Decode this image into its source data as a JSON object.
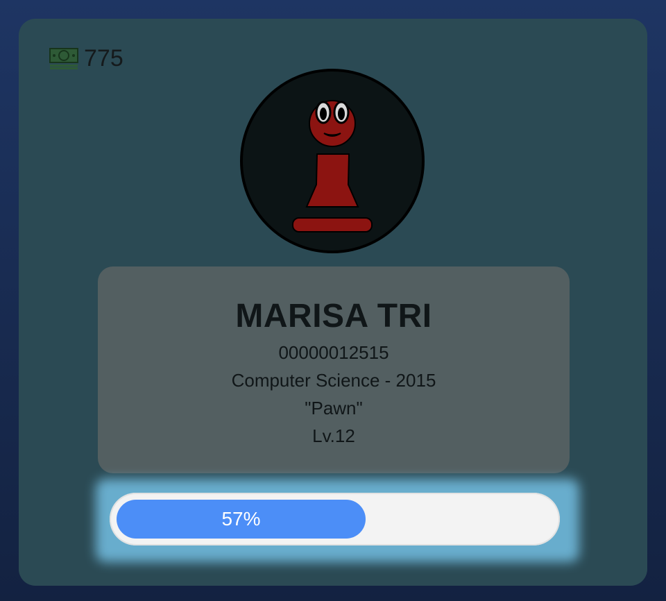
{
  "wallet": {
    "icon": "cash-icon",
    "amount": "775"
  },
  "avatar": {
    "icon": "pawn-character-icon"
  },
  "profile": {
    "name": "MARISA TRI",
    "id": "00000012515",
    "program": "Computer Science - 2015",
    "title": "\"Pawn\"",
    "level": "Lv.12"
  },
  "progress": {
    "percent": 57,
    "label": "57%"
  },
  "colors": {
    "background": "#1e3563",
    "card": "#2b4a54",
    "info_box": "#535f61",
    "progress_fill": "#4c8ef7",
    "progress_glow": "#6cb3d4",
    "pawn": "#8c1411"
  }
}
